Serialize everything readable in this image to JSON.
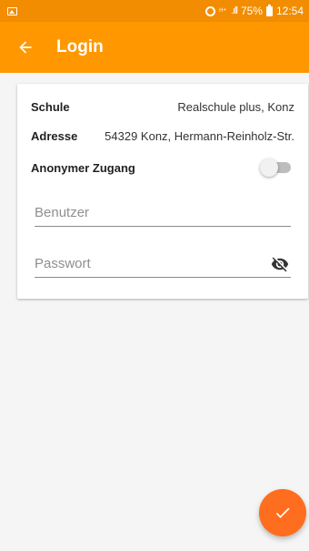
{
  "status_bar": {
    "left_icon": "image-notification-icon",
    "alarm_icon": "alarm-icon",
    "network_text": "ᴴ⁺",
    "signal_text": ".ıll",
    "battery": "75%",
    "time": "12:54"
  },
  "app_bar": {
    "back_icon": "arrow-back-icon",
    "title": "Login"
  },
  "login_card": {
    "school_label": "Schule",
    "school_value": "Realschule plus, Konz",
    "address_label": "Adresse",
    "address_value": "54329 Konz, Hermann-Reinholz-Str.",
    "anonymous_label": "Anonymer Zugang",
    "anonymous_enabled": false,
    "username_placeholder": "Benutzer",
    "username_value": "",
    "password_placeholder": "Passwort",
    "password_value": "",
    "password_toggle_icon": "eye-off-icon"
  },
  "fab": {
    "icon": "check-icon"
  },
  "colors": {
    "status_bar": "#f28c00",
    "app_bar": "#ff9800",
    "fab": "#ff6d1f",
    "background": "#f5f5f5"
  }
}
